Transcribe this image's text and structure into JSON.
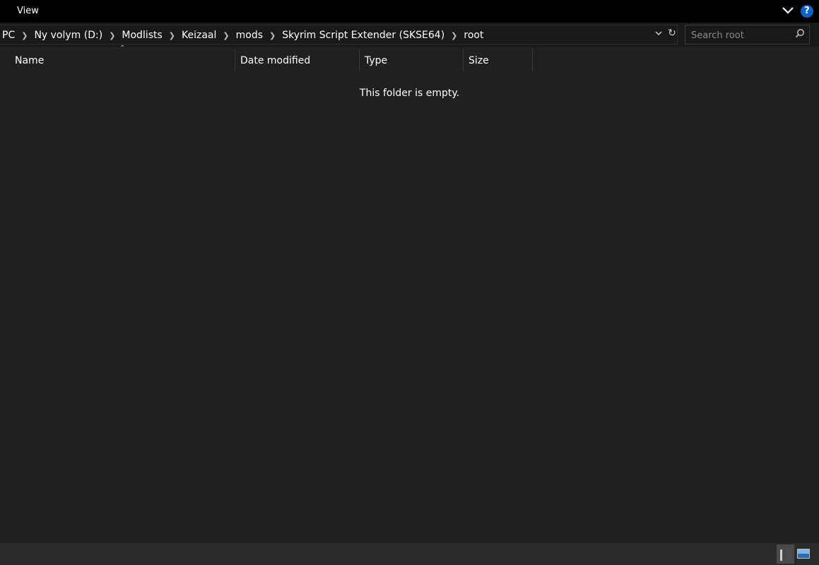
{
  "ribbon": {
    "menu_view": "View",
    "expand_icon": "chevron-down-icon",
    "help_label": "?"
  },
  "address": {
    "crumbs": [
      "PC",
      "Ny volym (D:)",
      "Modlists",
      "Keizaal",
      "mods",
      "Skyrim Script Extender (SKSE64)",
      "root"
    ],
    "separator_icon": "chevron-right-icon"
  },
  "search": {
    "placeholder": "Search root"
  },
  "columns": {
    "name": "Name",
    "date_modified": "Date modified",
    "type": "Type",
    "size": "Size",
    "sorted_by": "Name"
  },
  "content": {
    "empty_message": "This folder is empty."
  },
  "colors": {
    "background": "#202020",
    "ribbon": "#000000",
    "accent_help": "#0a64c8"
  }
}
